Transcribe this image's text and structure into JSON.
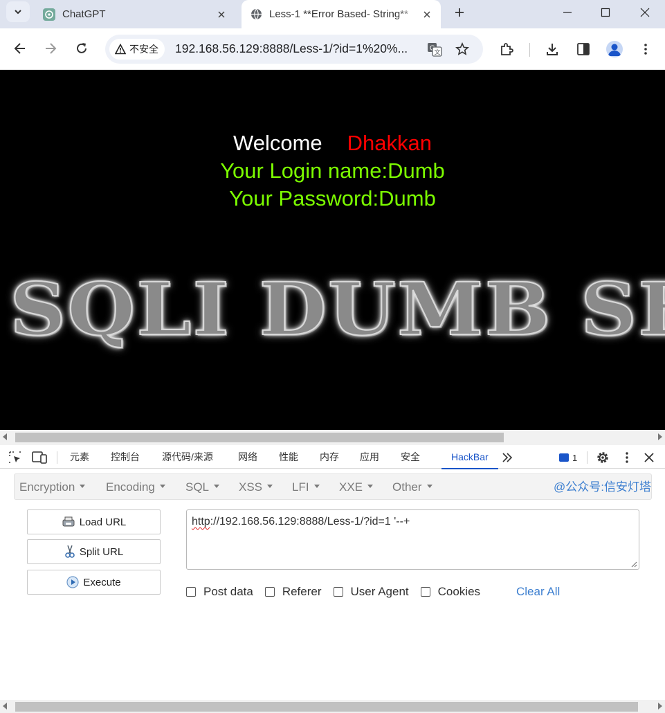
{
  "tabs": [
    {
      "title": "ChatGPT",
      "active": false
    },
    {
      "title": "Less-1 **Error Based- String**",
      "active": true
    }
  ],
  "omnibox": {
    "security_label": "不安全",
    "url": "192.168.56.129:8888/Less-1/?id=1%20%..."
  },
  "page": {
    "welcome_word": "Welcome",
    "welcome_name": "Dhakkan",
    "login_line": "Your Login name:Dumb",
    "password_line": "Your Password:Dumb",
    "banner_text": "SQLI DUMB SERIES"
  },
  "devtools": {
    "tabs": [
      "元素",
      "控制台",
      "源代码/来源",
      "网络",
      "性能",
      "内存",
      "应用",
      "安全",
      "HackBar"
    ],
    "active_tab": "HackBar",
    "issues_count": "1"
  },
  "hackbar": {
    "menus": [
      "Encryption",
      "Encoding",
      "SQL",
      "XSS",
      "LFI",
      "XXE",
      "Other"
    ],
    "watermark": "@公众号:信安灯塔",
    "buttons": {
      "load": "Load URL",
      "split": "Split URL",
      "execute": "Execute"
    },
    "url_scheme": "http",
    "url_rest": "://192.168.56.129:8888/Less-1/?id=1 '--+",
    "options": [
      {
        "label": "Post data",
        "checked": false
      },
      {
        "label": "Referer",
        "checked": false
      },
      {
        "label": "User Agent",
        "checked": false
      },
      {
        "label": "Cookies",
        "checked": false
      }
    ],
    "clear_all": "Clear All"
  },
  "colors": {
    "welcome_name": "#ff0000",
    "login_text": "#7cfc00",
    "accent_blue": "#1a55c9",
    "link_blue": "#3d7fd0"
  }
}
